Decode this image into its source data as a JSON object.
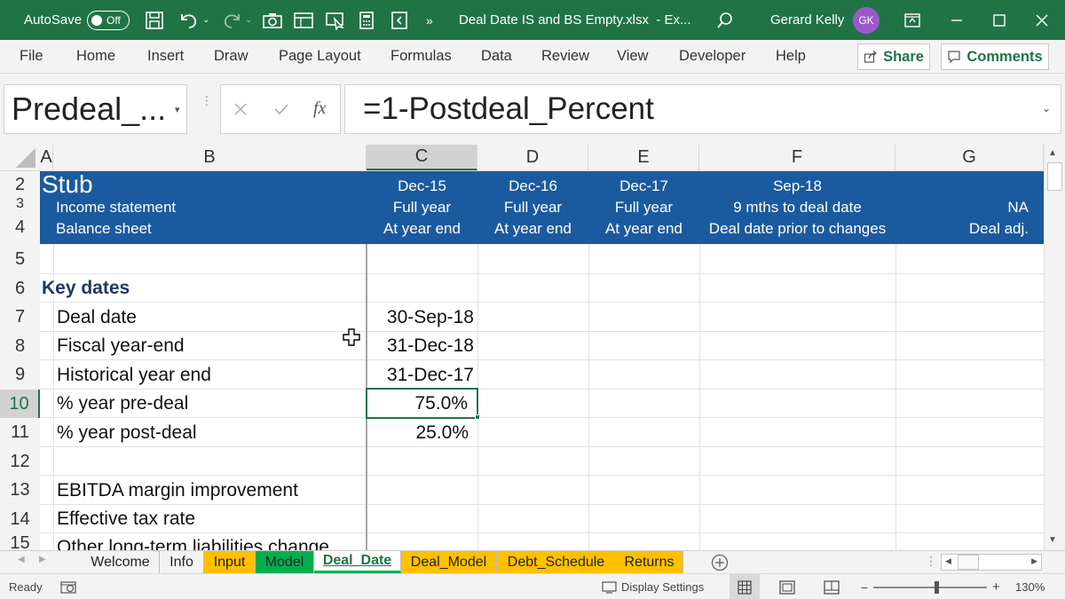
{
  "titlebar": {
    "autosave_label": "AutoSave",
    "autosave_state": "Off",
    "filename": "Deal Date IS and BS Empty.xlsx",
    "app_suffix": "-  Ex...",
    "overflow": "»",
    "user_name": "Gerard Kelly",
    "user_initials": "GK"
  },
  "ribbon": {
    "tabs": [
      "File",
      "Home",
      "Insert",
      "Draw",
      "Page Layout",
      "Formulas",
      "Data",
      "Review",
      "View",
      "Developer",
      "Help"
    ],
    "share_label": "Share",
    "comments_label": "Comments"
  },
  "formula_bar": {
    "name_box": "Predeal_...",
    "fx_label": "fx",
    "formula": "=1-Postdeal_Percent"
  },
  "columns": [
    "A",
    "B",
    "C",
    "D",
    "E",
    "F",
    "G"
  ],
  "rows": [
    "2",
    "3",
    "4",
    "5",
    "6",
    "7",
    "8",
    "9",
    "10",
    "11",
    "12",
    "13",
    "14",
    "15"
  ],
  "header_band": {
    "stub": "Stub",
    "income_statement": "Income statement",
    "balance_sheet": "Balance sheet",
    "C": [
      "Dec-15",
      "Full year",
      "At year end"
    ],
    "D": [
      "Dec-16",
      "Full year",
      "At year end"
    ],
    "E": [
      "Dec-17",
      "Full year",
      "At year end"
    ],
    "F": [
      "Sep-18",
      "9 mths to deal date",
      "Deal date prior to changes"
    ],
    "G": [
      "NA",
      "Deal adj."
    ]
  },
  "cells": {
    "key_dates": "Key dates",
    "deal_date_label": "Deal date",
    "fiscal_year_end_label": "Fiscal year-end",
    "historical_year_end_label": "Historical year end",
    "pre_deal_label": "% year pre-deal",
    "post_deal_label": "% year post-deal",
    "ebitda_label": "EBITDA margin improvement",
    "tax_label": "Effective tax rate",
    "other_liab_label": "Other long-term liabilities change",
    "deal_date_value": "30-Sep-18",
    "fiscal_year_end_value": "31-Dec-18",
    "historical_year_end_value": "31-Dec-17",
    "pre_deal_value": "75.0%",
    "post_deal_value": "25.0%"
  },
  "sheets": [
    {
      "name": "Welcome",
      "color": "#f3f3f3"
    },
    {
      "name": "Info",
      "color": "#f3f3f3"
    },
    {
      "name": "Input",
      "color": "#ffc000"
    },
    {
      "name": "Model",
      "color": "#00b050"
    },
    {
      "name": "Deal_Date",
      "color": "#ffffff"
    },
    {
      "name": "Deal_Model",
      "color": "#ffc000"
    },
    {
      "name": "Debt_Schedule",
      "color": "#ffc000"
    },
    {
      "name": "Returns",
      "color": "#ffc000"
    }
  ],
  "statusbar": {
    "ready": "Ready",
    "display_settings": "Display Settings",
    "zoom_minus": "−",
    "zoom_plus": "+",
    "zoom": "130%"
  },
  "colors": {
    "excel_green": "#217346",
    "header_blue": "#1b5a9e",
    "key_dates_text": "#1f3864"
  }
}
